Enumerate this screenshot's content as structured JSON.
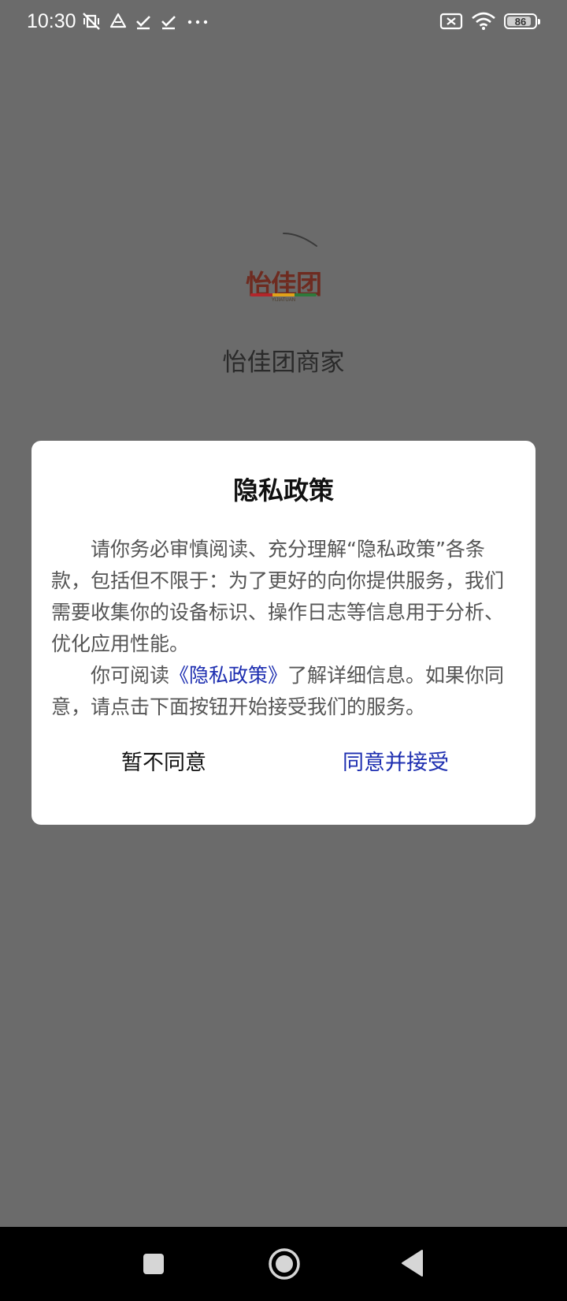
{
  "status_bar": {
    "time": "10:30",
    "battery_level": "86",
    "icons": [
      "mute-vibrate-icon",
      "drive-icon",
      "download-done-icon",
      "download-done-icon",
      "more-dots-icon",
      "sim-off-icon",
      "wifi-icon",
      "battery-icon"
    ]
  },
  "splash": {
    "logo_text": "怡佳团",
    "logo_subtext": "YIJIATUAN",
    "app_name": "怡佳团商家",
    "logo_colors": [
      "#b3262b",
      "#e0a21a",
      "#2d7a3c"
    ]
  },
  "dialog": {
    "title": "隐私政策",
    "paragraph1": "请你务必审慎阅读、充分理解“隐私政策”各条款，包括但不限于：为了更好的向你提供服务，我们需要收集你的设备标识、操作日志等信息用于分析、优化应用性能。",
    "paragraph2_prefix": "你可阅读",
    "paragraph2_link": "《隐私政策》",
    "paragraph2_suffix": "了解详细信息。如果你同意，请点击下面按钮开始接受我们的服务。",
    "decline_label": "暂不同意",
    "accept_label": "同意并接受",
    "accept_color": "#1d2eb0"
  },
  "nav_bar": {
    "buttons": [
      "recent-apps-icon",
      "home-icon",
      "back-icon"
    ]
  }
}
